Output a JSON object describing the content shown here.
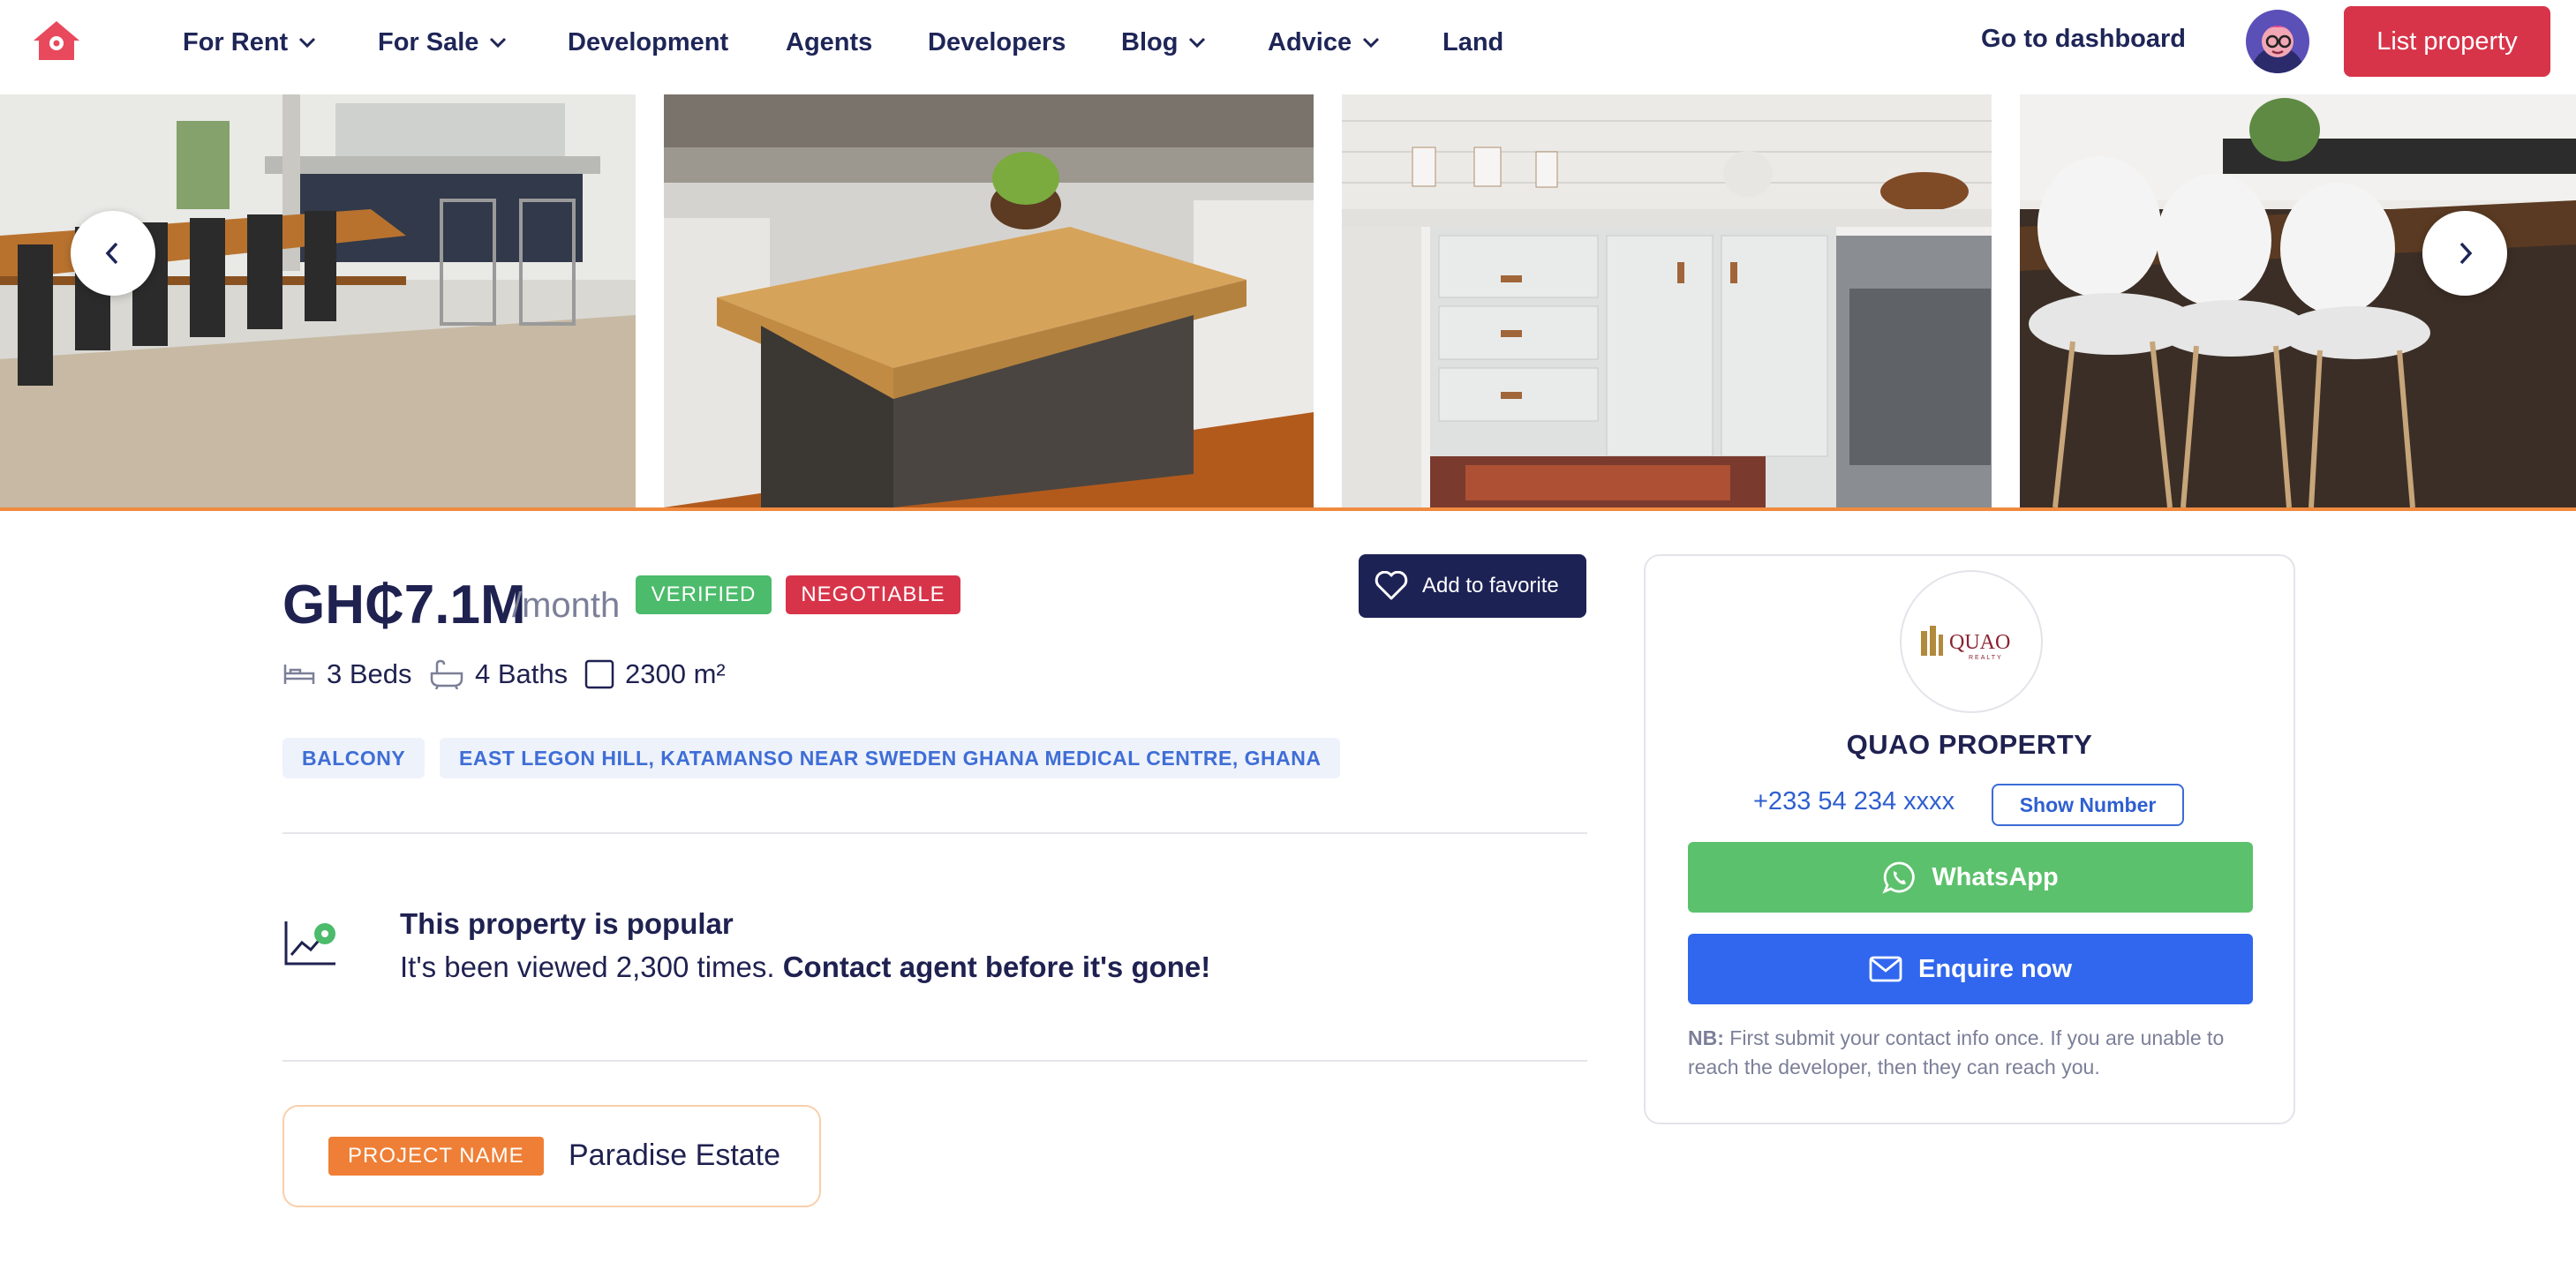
{
  "nav": {
    "logo_icon": "home-pin-icon",
    "items": [
      {
        "label": "For Rent",
        "dropdown": true
      },
      {
        "label": "For Sale",
        "dropdown": true
      },
      {
        "label": "Development",
        "dropdown": false
      },
      {
        "label": "Agents",
        "dropdown": false
      },
      {
        "label": "Developers",
        "dropdown": false
      },
      {
        "label": "Blog",
        "dropdown": true
      },
      {
        "label": "Advice",
        "dropdown": true
      },
      {
        "label": "Land",
        "dropdown": false
      }
    ],
    "dashboard_label": "Go to dashboard",
    "list_property_label": "List property"
  },
  "gallery": {
    "prev_icon": "chevron-left-icon",
    "next_icon": "chevron-right-icon",
    "photos": [
      "dining room with long wooden table",
      "kitchen island with butcher block top",
      "white kitchen cabinets with hexagon backsplash",
      "white chairs at kitchen counter"
    ],
    "accent_color": "#f08a3e"
  },
  "listing": {
    "price": "GH₵7.1M",
    "period": "/month",
    "badges": [
      {
        "label": "VERIFIED",
        "color": "#4cbb6b"
      },
      {
        "label": "NEGOTIABLE",
        "color": "#d7344a"
      }
    ],
    "favorite_label": "Add to favorite",
    "features": [
      {
        "icon": "bed-icon",
        "label": "3 Beds"
      },
      {
        "icon": "bathtub-icon",
        "label": "4 Baths"
      },
      {
        "icon": "area-square-icon",
        "label": "2300 m²"
      }
    ],
    "tags": [
      "BALCONY",
      "EAST LEGON HILL, KATAMANSO NEAR SWEDEN GHANA MEDICAL CENTRE, GHANA"
    ],
    "popular": {
      "title": "This property is popular",
      "text": "It's been viewed 2,300 times.",
      "cta": "Contact agent before it's gone!"
    },
    "project": {
      "label": "PROJECT NAME",
      "name": "Paradise Estate"
    }
  },
  "agent": {
    "logo_text": "QUAO",
    "logo_subtext": "REALTY",
    "name": "QUAO PROPERTY",
    "phone": "+233 54 234 xxxx",
    "show_number_label": "Show Number",
    "whatsapp_label": "WhatsApp",
    "enquire_label": "Enquire now",
    "note_prefix": "NB:",
    "note_text": "First submit your contact info once. If you are unable to reach the developer, then they can reach you."
  },
  "colors": {
    "primary_text": "#1f2150",
    "brand_red": "#d7344a",
    "whatsapp_green": "#5cc16c",
    "enquire_blue": "#3167ee",
    "navy": "#1d2255"
  }
}
